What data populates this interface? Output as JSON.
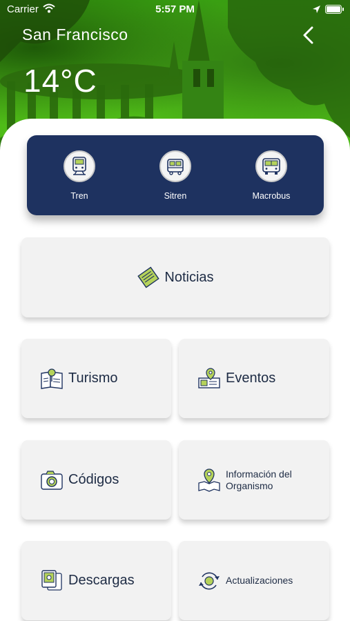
{
  "status": {
    "carrier": "Carrier",
    "time": "5:57 PM"
  },
  "header": {
    "city": "San Francisco",
    "temperature": "14°C"
  },
  "transport": [
    {
      "label": "Tren",
      "icon": "train-icon"
    },
    {
      "label": "Sitren",
      "icon": "light-rail-icon"
    },
    {
      "label": "Macrobus",
      "icon": "bus-icon"
    }
  ],
  "menu": {
    "noticias": "Noticias",
    "turismo": "Turismo",
    "eventos": "Eventos",
    "codigos": "Códigos",
    "informacion": "Información del Organismo",
    "descargas": "Descargas",
    "actualizaciones": "Actualizaciones"
  },
  "colors": {
    "accent": "#1e3260",
    "hero_green": "#4cb816",
    "card": "#f2f2f2",
    "text": "#1d2b44"
  }
}
